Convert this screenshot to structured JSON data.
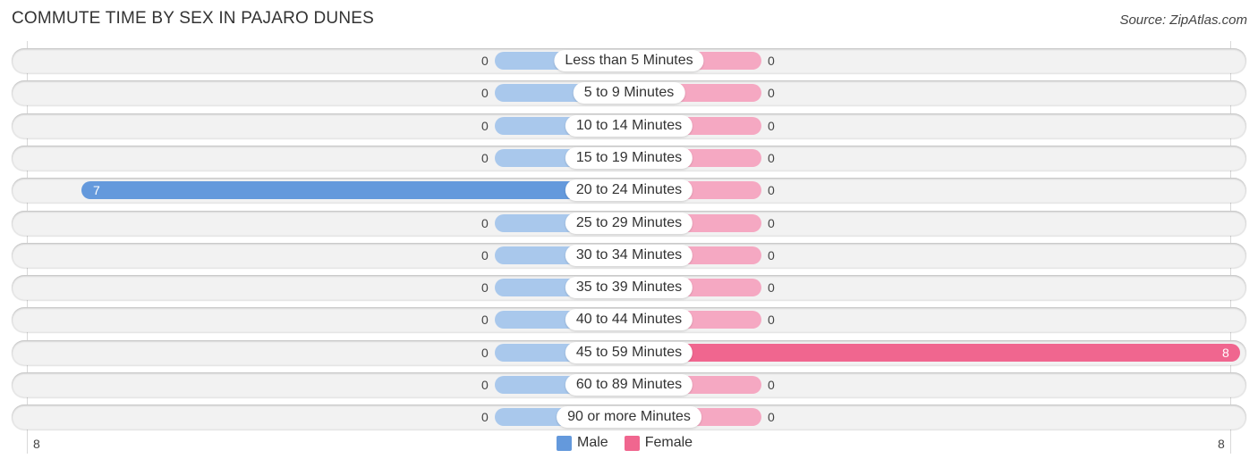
{
  "chart_data": {
    "type": "bar",
    "orientation": "horizontal-diverging",
    "title": "COMMUTE TIME BY SEX IN PAJARO DUNES",
    "source": "Source: ZipAtlas.com",
    "categories": [
      "Less than 5 Minutes",
      "5 to 9 Minutes",
      "10 to 14 Minutes",
      "15 to 19 Minutes",
      "20 to 24 Minutes",
      "25 to 29 Minutes",
      "30 to 34 Minutes",
      "35 to 39 Minutes",
      "40 to 44 Minutes",
      "45 to 59 Minutes",
      "60 to 89 Minutes",
      "90 or more Minutes"
    ],
    "series": [
      {
        "name": "Male",
        "color": "#6499dc",
        "values": [
          0,
          0,
          0,
          0,
          7,
          0,
          0,
          0,
          0,
          0,
          0,
          0
        ]
      },
      {
        "name": "Female",
        "color": "#f0668f",
        "values": [
          0,
          0,
          0,
          0,
          0,
          0,
          0,
          0,
          0,
          8,
          0,
          0
        ]
      }
    ],
    "axis": {
      "left_max_label": "8",
      "right_max_label": "8",
      "range": [
        8,
        8
      ]
    },
    "legend": {
      "position": "bottom-center",
      "items": [
        "Male",
        "Female"
      ]
    }
  }
}
